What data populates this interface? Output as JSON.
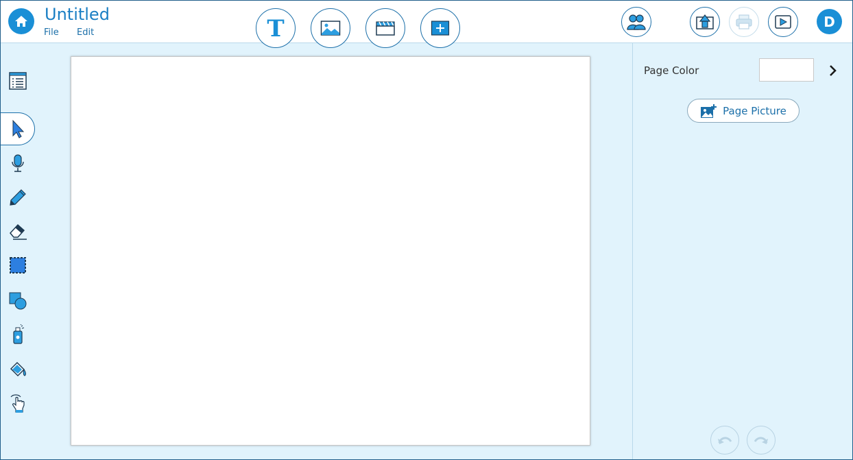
{
  "document": {
    "title": "Untitled",
    "menu": [
      "File",
      "Edit"
    ]
  },
  "header": {
    "home_icon": "home-icon",
    "insert_buttons": [
      "text-icon",
      "image-icon",
      "video-clapper-icon",
      "add-box-icon"
    ],
    "right_buttons": [
      "collaborate-icon",
      "share-upload-icon",
      "print-icon",
      "present-play-icon"
    ],
    "avatar_letter": "D"
  },
  "tools": [
    "page-list-icon",
    "select-arrow-icon",
    "microphone-icon",
    "pencil-icon",
    "eraser-icon",
    "selection-box-icon",
    "shapes-icon",
    "spray-paint-icon",
    "paint-bucket-icon",
    "touch-hand-icon"
  ],
  "selected_tool": "select-arrow-icon",
  "side_panel": {
    "page_color_label": "Page Color",
    "page_color_value": "#ffffff",
    "page_picture_label": "Page Picture"
  },
  "colors": {
    "accent": "#1a8fd6",
    "panel_background": "#e1f3fc",
    "text_link": "#1b6fa9"
  }
}
